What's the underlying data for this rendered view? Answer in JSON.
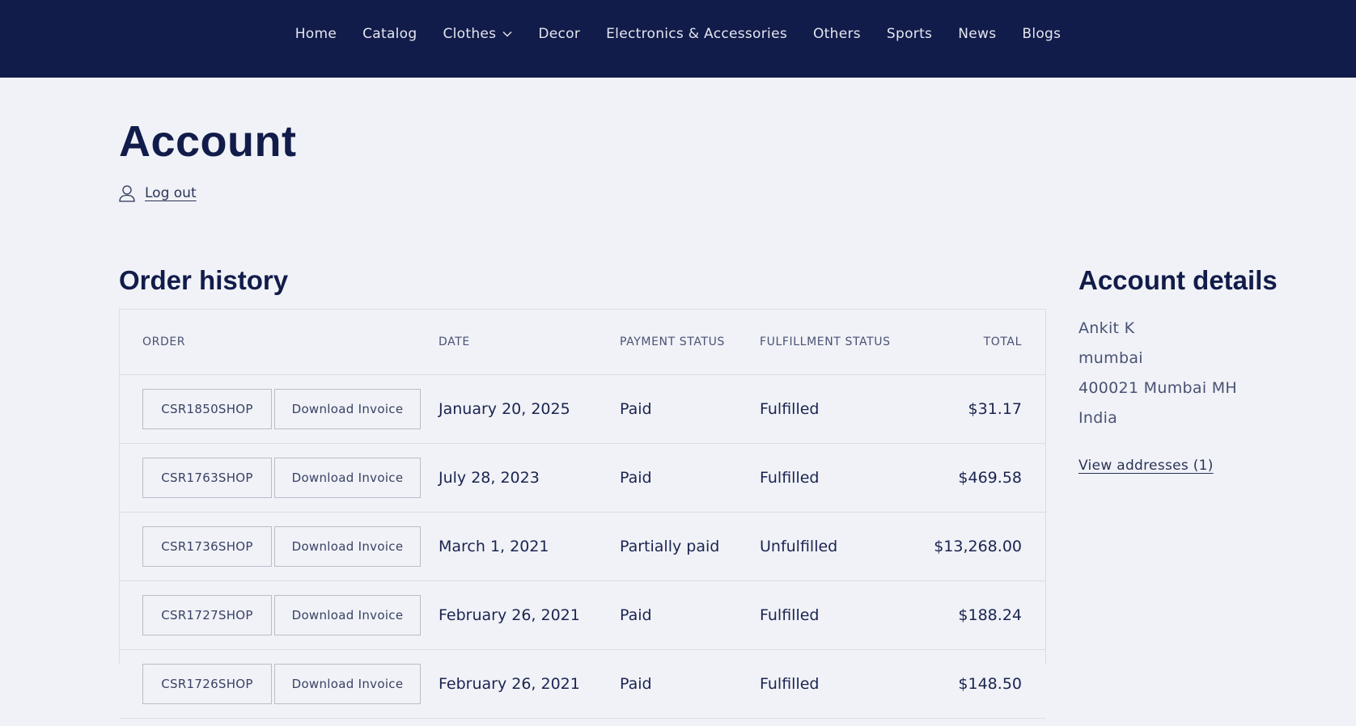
{
  "nav": {
    "items": [
      {
        "label": "Home"
      },
      {
        "label": "Catalog"
      },
      {
        "label": "Clothes",
        "dropdown": true
      },
      {
        "label": "Decor"
      },
      {
        "label": "Electronics & Accessories"
      },
      {
        "label": "Others"
      },
      {
        "label": "Sports"
      },
      {
        "label": "News"
      },
      {
        "label": "Blogs"
      }
    ]
  },
  "page": {
    "title": "Account",
    "logout_label": "Log out"
  },
  "orders": {
    "title": "Order history",
    "headers": {
      "order": "ORDER",
      "date": "DATE",
      "payment": "PAYMENT STATUS",
      "fulfillment": "FULFILLMENT STATUS",
      "total": "TOTAL"
    },
    "invoice_label": "Download Invoice",
    "rows": [
      {
        "id": "CSR1850SHOP",
        "date": "January 20, 2025",
        "payment": "Paid",
        "fulfillment": "Fulfilled",
        "total": "$31.17"
      },
      {
        "id": "CSR1763SHOP",
        "date": "July 28, 2023",
        "payment": "Paid",
        "fulfillment": "Fulfilled",
        "total": "$469.58"
      },
      {
        "id": "CSR1736SHOP",
        "date": "March 1, 2021",
        "payment": "Partially paid",
        "fulfillment": "Unfulfilled",
        "total": "$13,268.00"
      },
      {
        "id": "CSR1727SHOP",
        "date": "February 26, 2021",
        "payment": "Paid",
        "fulfillment": "Fulfilled",
        "total": "$188.24"
      },
      {
        "id": "CSR1726SHOP",
        "date": "February 26, 2021",
        "payment": "Paid",
        "fulfillment": "Fulfilled",
        "total": "$148.50"
      }
    ]
  },
  "account_details": {
    "title": "Account details",
    "name": "Ankit K",
    "address1": "mumbai",
    "city_line": "400021 Mumbai MH",
    "country": "India",
    "view_addresses": "View addresses (1)"
  },
  "colors": {
    "nav_bg": "#121c4a",
    "page_bg": "#f0f2f7",
    "text": "#121c4a"
  }
}
